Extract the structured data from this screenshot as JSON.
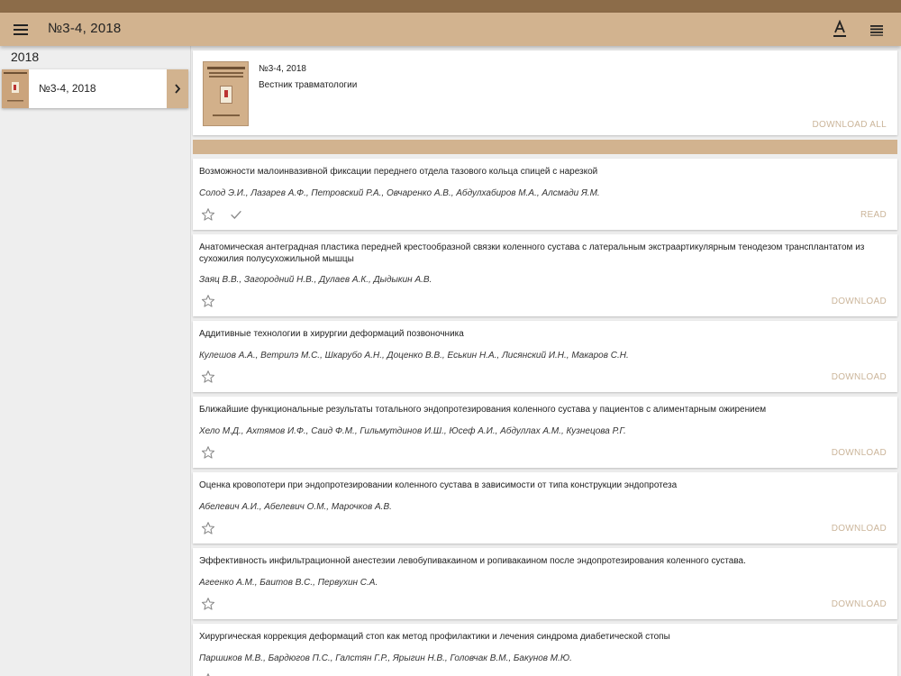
{
  "app": {
    "title": "№3-4, 2018"
  },
  "colors": {
    "accent": "#d2b38f",
    "status_bar": "#8c6c49",
    "action_text": "#cbb59a"
  },
  "toolbar": {
    "menu_icon": "menu-icon",
    "font_icon": "text-format-icon",
    "list_icon": "list-icon"
  },
  "sidebar": {
    "year": "2018",
    "issue_label": "№3-4, 2018",
    "chevron_icon": "chevron-right-icon"
  },
  "issue_header": {
    "issue": "№3-4, 2018",
    "journal": "Вестник травматологии",
    "download_all": "DOWNLOAD ALL"
  },
  "articles": [
    {
      "title": "Возможности малоинвазивной фиксации переднего отдела тазового кольца спицей с нарезкой",
      "authors": "Солод Э.И., Лазарев А.Ф., Петровский Р.А., Овчаренко А.В., Абдулхабиров М.А., Алсмади Я.М.",
      "action": "READ",
      "downloaded": true
    },
    {
      "title": "Анатомическая антеградная пластика передней крестообразной связки коленного сустава с латеральным экстраартикулярным тенодезом трансплантатом из сухожилия полусухожильной мышцы",
      "authors": "Заяц В.В., Загородний Н.В., Дулаев А.К., Дыдыкин А.В.",
      "action": "DOWNLOAD"
    },
    {
      "title": "Аддитивные технологии в хирургии деформаций позвоночника",
      "authors": "Кулешов А.А., Ветрилэ М.С., Шкарубо А.Н., Доценко В.В., Еськин Н.А., Лисянский И.Н., Макаров С.Н.",
      "action": "DOWNLOAD"
    },
    {
      "title": "Ближайшие функциональные результаты тотального эндопротезирования коленного сустава у пациентов с алиментарным ожирением",
      "authors": "Хело М.Д., Ахтямов И.Ф., Саид Ф.М., Гильмутдинов И.Ш., Юсеф А.И., Абдуллах А.М., Кузнецова Р.Г.",
      "action": "DOWNLOAD"
    },
    {
      "title": "Оценка кровопотери при эндопротезировании коленного сустава в зависимости от типа конструкции эндопротеза",
      "authors": "Абелевич А.И., Абелевич О.М., Марочков А.В.",
      "action": "DOWNLOAD"
    },
    {
      "title": "Эффективность инфильтрационной анестезии левобупивакаином и ропивакаином после эндопротезирования коленного сустава.",
      "authors": "Агеенко А.М., Баитов В.С., Первухин С.А.",
      "action": "DOWNLOAD"
    },
    {
      "title": "Хирургическая коррекция деформаций стоп как метод профилактики и лечения синдрома диабетической стопы",
      "authors": "Паршиков М.В., Бардюгов П.С., Галстян Г.Р., Ярыгин Н.В., Головчак В.М., Бакунов М.Ю.",
      "action": ""
    }
  ]
}
